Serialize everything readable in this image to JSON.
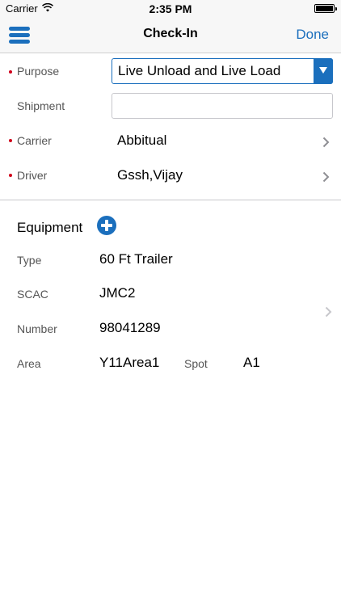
{
  "status_bar": {
    "carrier": "Carrier",
    "time": "2:35 PM"
  },
  "nav": {
    "title": "Check-In",
    "done_label": "Done",
    "menu_icon": "hamburger-menu-icon"
  },
  "form": {
    "purpose": {
      "label": "Purpose",
      "required": true,
      "value": "Live Unload and Live Load"
    },
    "shipment": {
      "label": "Shipment",
      "required": false,
      "value": ""
    },
    "carrier": {
      "label": "Carrier",
      "required": true,
      "value": "Abbitual"
    },
    "driver": {
      "label": "Driver",
      "required": true,
      "value": "Gssh,Vijay"
    }
  },
  "equipment": {
    "title": "Equipment",
    "add_icon": "plus-circle-icon",
    "type": {
      "label": "Type",
      "value": "60 Ft Trailer"
    },
    "scac": {
      "label": "SCAC",
      "value": "JMC2"
    },
    "number": {
      "label": "Number",
      "value": "98041289"
    },
    "area": {
      "label": "Area",
      "value": "Y11Area1"
    },
    "spot": {
      "label": "Spot",
      "value": "A1"
    }
  },
  "colors": {
    "accent": "#1b6fbd",
    "required": "#d0021b",
    "bar_bg": "#f7f7f7"
  }
}
